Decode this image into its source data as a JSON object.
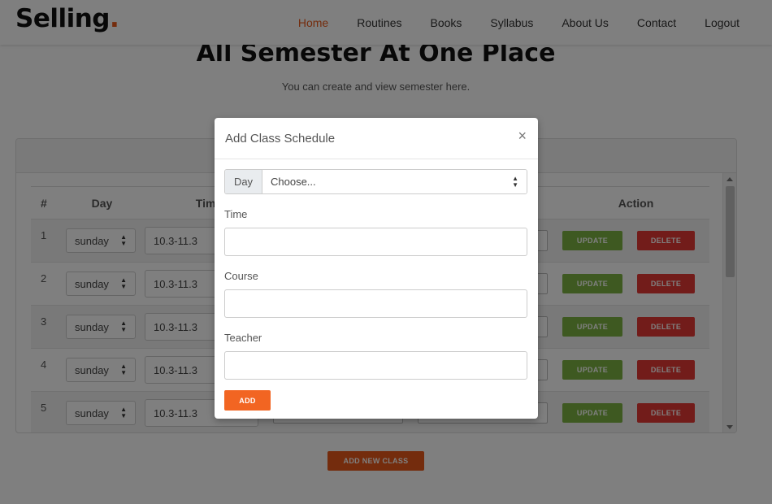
{
  "navbar": {
    "brand": "Selling",
    "brand_dot": ".",
    "links": [
      "Home",
      "Routines",
      "Books",
      "Syllabus",
      "About Us",
      "Contact",
      "Logout"
    ],
    "active": "Home"
  },
  "hero": {
    "title": "All Semester At One Place",
    "subtitle": "You can create and view semester here."
  },
  "table": {
    "headers": {
      "num": "#",
      "day": "Day",
      "time": "Time",
      "action": "Action"
    },
    "rows": [
      {
        "num": "1",
        "day": "sunday",
        "time": "10.3-11.3"
      },
      {
        "num": "2",
        "day": "sunday",
        "time": "10.3-11.3"
      },
      {
        "num": "3",
        "day": "sunday",
        "time": "10.3-11.3"
      },
      {
        "num": "4",
        "day": "sunday",
        "time": "10.3-11.3"
      },
      {
        "num": "5",
        "day": "sunday",
        "time": "10.3-11.3"
      }
    ],
    "update_label": "UPDATE",
    "delete_label": "DELETE"
  },
  "add_new_class_label": "ADD NEW CLASS",
  "modal": {
    "title": "Add Class Schedule",
    "close": "×",
    "day_addon": "Day",
    "day_value": "Choose...",
    "time_label": "Time",
    "time_value": "",
    "course_label": "Course",
    "course_value": "",
    "teacher_label": "Teacher",
    "teacher_value": "",
    "add_label": "ADD"
  },
  "colors": {
    "accent": "#e8591a",
    "update": "#7cb342",
    "delete": "#e53935",
    "add": "#f26522"
  }
}
